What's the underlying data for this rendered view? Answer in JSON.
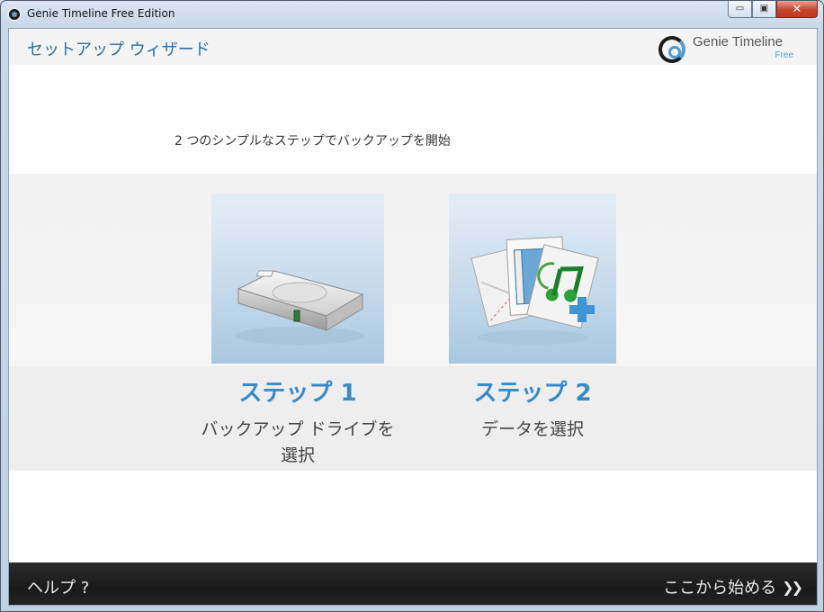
{
  "window": {
    "title": "Genie Timeline Free Edition",
    "minimize_label": "▭",
    "maximize_label": "▣",
    "close_label": "✕"
  },
  "header": {
    "title": "セットアップ ウィザード",
    "logo_name": "Genie Timeline",
    "logo_edition": "Free"
  },
  "intro": "2 つのシンプルなステップでバックアップを開始",
  "steps": [
    {
      "label": "ステップ 1",
      "description": "バックアップ ドライブを選択",
      "icon": "hard-drive-icon"
    },
    {
      "label": "ステップ 2",
      "description": "データを選択",
      "icon": "files-add-icon"
    }
  ],
  "footer": {
    "help_label": "ヘルプ ?",
    "start_label": "ここから始める",
    "start_icon": "double-chevron-right-icon"
  },
  "colors": {
    "accent": "#3a8ac4",
    "title_blue": "#2b6fa6",
    "footer_bg": "#222222"
  }
}
